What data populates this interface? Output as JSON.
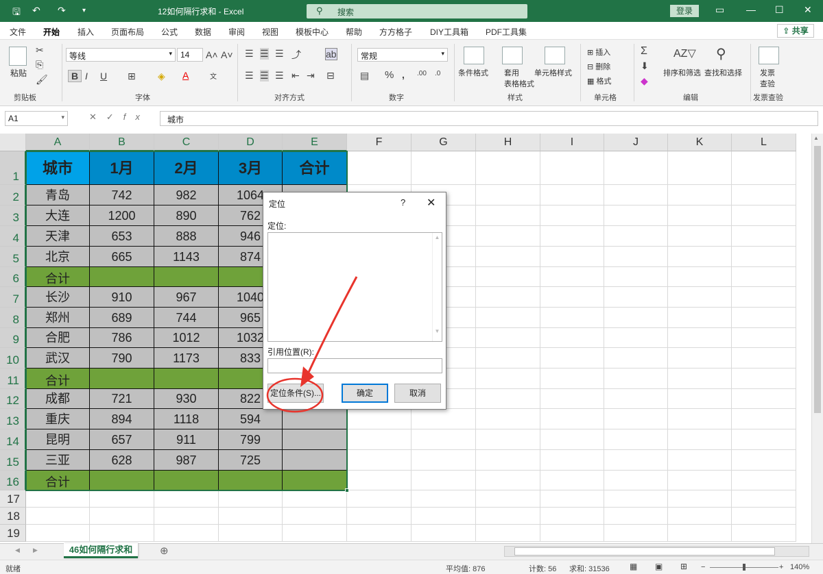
{
  "titlebar": {
    "doc_title": "12如何隔行求和 - Excel",
    "search_text": "搜索",
    "login": "登录"
  },
  "menu": {
    "tabs": [
      "文件",
      "开始",
      "插入",
      "页面布局",
      "公式",
      "数据",
      "审阅",
      "视图",
      "模板中心",
      "帮助",
      "方方格子",
      "DIY工具箱",
      "PDF工具集"
    ],
    "share": "共享"
  },
  "ribbon": {
    "clipboard": {
      "paste": "粘贴",
      "label": "剪贴板"
    },
    "font": {
      "name": "等线",
      "size": "14",
      "bold": "B",
      "italic": "I",
      "underline": "U",
      "label": "字体"
    },
    "align": {
      "label": "对齐方式"
    },
    "number": {
      "format": "常规",
      "percent": "%",
      "label": "数字"
    },
    "styles": {
      "cond": "条件格式",
      "table": "套用\n表格格式",
      "cell": "单元格样式",
      "label": "样式"
    },
    "cells": {
      "insert": "插入",
      "delete": "删除",
      "format": "格式",
      "label": "单元格"
    },
    "edit": {
      "sort": "排序和筛选",
      "find": "查找和选择",
      "label": "编辑"
    },
    "invoice": {
      "check": "发票\n查验",
      "label": "发票查验"
    }
  },
  "formula": {
    "namebox": "A1",
    "content": "城市"
  },
  "grid": {
    "col_headers": [
      "A",
      "B",
      "C",
      "D",
      "E",
      "F",
      "G",
      "H",
      "I",
      "J",
      "K",
      "L"
    ],
    "row_headers": [
      "1",
      "2",
      "3",
      "4",
      "5",
      "6",
      "7",
      "8",
      "9",
      "10",
      "11",
      "12",
      "13",
      "14",
      "15",
      "16",
      "17",
      "18",
      "19"
    ],
    "header_row": [
      "城市",
      "1月",
      "2月",
      "3月",
      "合计"
    ],
    "rows": [
      [
        "青岛",
        "742",
        "982",
        "1064"
      ],
      [
        "大连",
        "1200",
        "890",
        "762"
      ],
      [
        "天津",
        "653",
        "888",
        "946"
      ],
      [
        "北京",
        "665",
        "1143",
        "874"
      ],
      [
        "合计",
        "",
        "",
        ""
      ],
      [
        "长沙",
        "910",
        "967",
        "1040"
      ],
      [
        "郑州",
        "689",
        "744",
        "965"
      ],
      [
        "合肥",
        "786",
        "1012",
        "1032"
      ],
      [
        "武汉",
        "790",
        "1173",
        "833"
      ],
      [
        "合计",
        "",
        "",
        ""
      ],
      [
        "成都",
        "721",
        "930",
        "822"
      ],
      [
        "重庆",
        "894",
        "1118",
        "594"
      ],
      [
        "昆明",
        "657",
        "911",
        "799"
      ],
      [
        "三亚",
        "628",
        "987",
        "725"
      ],
      [
        "合计",
        "",
        "",
        ""
      ]
    ]
  },
  "dialog": {
    "title": "定位",
    "help": "?",
    "close": "✕",
    "goto_label": "定位:",
    "ref_label": "引用位置(R):",
    "special_btn": "定位条件(S)...",
    "ok_btn": "确定",
    "cancel_btn": "取消"
  },
  "sheet": {
    "tab": "46如何隔行求和"
  },
  "status": {
    "ready": "就绪",
    "average": "平均值: 876",
    "count": "计数: 56",
    "sum": "求和: 31536",
    "zoom": "140%"
  },
  "colors": {
    "excel_green": "#217346",
    "header_blue": "#00a2e8",
    "total_green": "#6fa23a",
    "data_gray": "#c0c0c0",
    "annotation_red": "#e8342c"
  }
}
